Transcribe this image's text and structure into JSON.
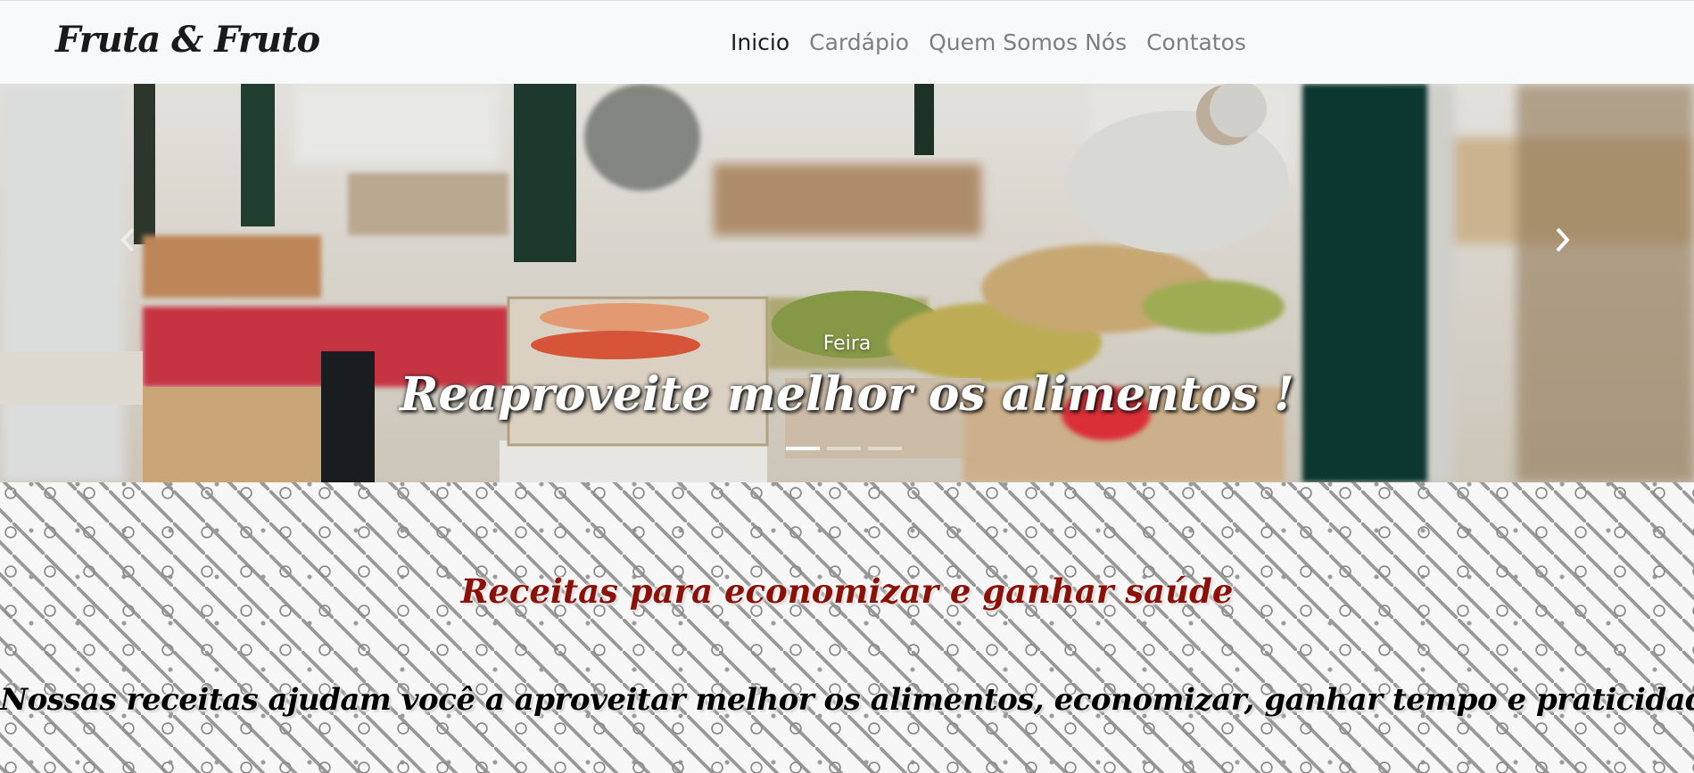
{
  "navbar": {
    "brand": "Fruta & Fruto",
    "links": [
      {
        "label": "Inicio",
        "active": true
      },
      {
        "label": "Cardápio",
        "active": false
      },
      {
        "label": "Quem Somos Nós",
        "active": false
      },
      {
        "label": "Contatos",
        "active": false
      }
    ]
  },
  "carousel": {
    "subtitle": "Feira",
    "title": "Reaproveite melhor os alimentos !",
    "slide_count": 3,
    "active_slide": 1,
    "prev_icon": "chevron-left-icon",
    "next_icon": "chevron-right-icon"
  },
  "recipes": {
    "title": "Receitas para economizar e ganhar saúde",
    "text": "Nossas receitas ajudam você a aproveitar melhor os alimentos, economizar, ganhar tempo e praticidade"
  },
  "colors": {
    "navbar_bg": "#f8f9fa",
    "nav_active": "#1e1e1e",
    "nav_inactive": "#7b7e83",
    "recipes_title": "#8a1008",
    "caption": "#ffffff"
  }
}
